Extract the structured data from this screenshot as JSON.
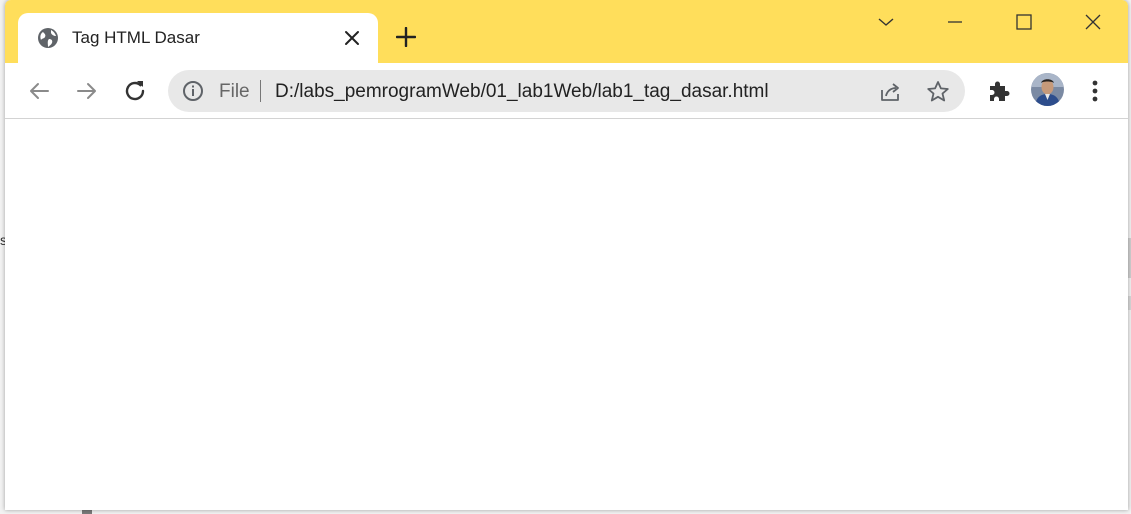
{
  "colors": {
    "tabstrip_bg": "#ffde5b",
    "omnibox_bg": "#e8e8e8",
    "icon": "#5f6368"
  },
  "background": {
    "left_text": "s"
  },
  "tab": {
    "title": "Tag HTML Dasar",
    "favicon": "globe-icon",
    "close_icon": "close-icon"
  },
  "tabstrip": {
    "new_tab_icon": "plus-icon"
  },
  "window_controls": {
    "tab_search_icon": "chevron-down-icon",
    "minimize_icon": "minimize-icon",
    "maximize_icon": "maximize-icon",
    "close_icon": "close-icon"
  },
  "toolbar": {
    "back_icon": "back-arrow-icon",
    "forward_icon": "forward-arrow-icon",
    "reload_icon": "reload-icon",
    "extensions_icon": "puzzle-icon",
    "menu_icon": "kebab-menu-icon"
  },
  "omnibox": {
    "scheme_label": "File",
    "url": "D:/labs_pemrogramWeb/01_lab1Web/lab1_tag_dasar.html",
    "info_icon": "info-icon",
    "share_icon": "share-icon",
    "bookmark_icon": "star-icon"
  },
  "content": {}
}
